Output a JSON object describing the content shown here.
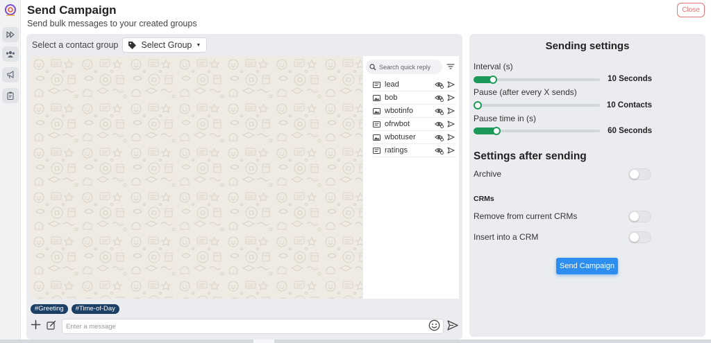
{
  "header": {
    "title": "Send Campaign",
    "subtitle": "Send bulk messages to your created groups",
    "close_label": "Close"
  },
  "sidebar": {
    "items": [
      {
        "icon": "fast-forward-icon"
      },
      {
        "icon": "users-icon"
      },
      {
        "icon": "megaphone-icon"
      },
      {
        "icon": "clipboard-icon"
      }
    ]
  },
  "contact_group": {
    "label": "Select a contact group",
    "dropdown_label": "Select Group"
  },
  "quick_reply": {
    "search_placeholder": "Search quick reply",
    "items": [
      {
        "type": "text",
        "label": "lead"
      },
      {
        "type": "image",
        "label": "bob"
      },
      {
        "type": "image",
        "label": "wbotinfo"
      },
      {
        "type": "text",
        "label": "ofrwbot"
      },
      {
        "type": "image",
        "label": "wbotuser"
      },
      {
        "type": "text",
        "label": "ratings"
      }
    ]
  },
  "tags": [
    "#Greeting",
    "#Time-of-Day"
  ],
  "composer": {
    "placeholder": "Enter a message"
  },
  "sending_settings": {
    "title": "Sending settings",
    "interval_label": "Interval (s)",
    "interval_value": "10 Seconds",
    "interval_fraction": 0.12,
    "pause_label": "Pause (after every X sends)",
    "pause_value": "10 Contacts",
    "pause_fraction": 0.0,
    "pause_time_label": "Pause time in (s)",
    "pause_time_value": "60 Seconds",
    "pause_time_fraction": 0.15
  },
  "after_sending": {
    "title": "Settings after sending",
    "archive_label": "Archive",
    "archive_on": false,
    "crms_title": "CRMs",
    "remove_label": "Remove from current CRMs",
    "remove_on": false,
    "insert_label": "Insert into a CRM",
    "insert_on": false
  },
  "send_button_label": "Send Campaign",
  "colors": {
    "accent_green": "#1b9a59",
    "primary_blue": "#2e8ef0",
    "tag_navy": "#1c3f66",
    "close_red": "#e57373",
    "chat_bg": "#efeae2"
  }
}
